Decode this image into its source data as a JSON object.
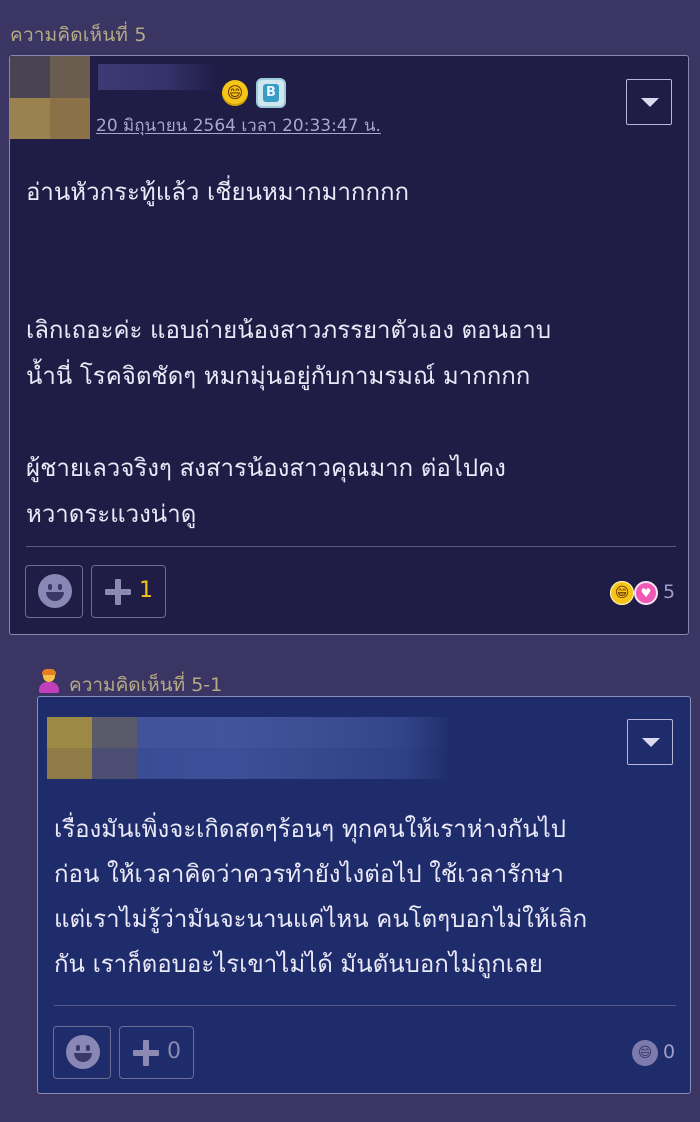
{
  "comment": {
    "header": "ความคิดเห็นที่ 5",
    "emoji_badge": "😄",
    "member_badge": "B",
    "timestamp": "20 มิถุนายน 2564 เวลา 20:33:47 น.",
    "paragraphs": [
      "อ่านหัวกระทู้แล้ว  เชี่ยนหมากมากกกก",
      "เลิกเถอะค่ะ  แอบถ่ายน้องสาวภรรยาตัวเอง  ตอนอาบ\nน้ำนี่  โรคจิตชัดๆ  หมกมุ่นอยู่กับกามรมณ์ มากกกก",
      "ผู้ชายเลวจริงๆ  สงสารน้องสาวคุณมาก  ต่อไปคง\nหวาดระแวงน่าดู"
    ],
    "plus_count": "1",
    "reaction_emoji": "😁",
    "reaction_heart": "♥",
    "reaction_count": "5",
    "accent_color": "#f0c419"
  },
  "reply": {
    "header": "ความคิดเห็นที่ 5-1",
    "text": "เรื่องมันเพิ่งจะเกิดสดๆร้อนๆ ทุกคนให้เราห่างกันไป\nก่อน ให้เวลาคิดว่าควรทำยังไงต่อไป ใช้เวลารักษา\nแต่เราไม่รู้ว่ามันจะนานแค่ไหน คนโตๆบอกไม่ให้เลิก\nกัน เราก็ตอบอะไรเขาไม่ได้ มันตันบอกไม่ถูกเลย",
    "plus_count": "0",
    "reaction_emoji": "😄",
    "reaction_count": "0"
  }
}
